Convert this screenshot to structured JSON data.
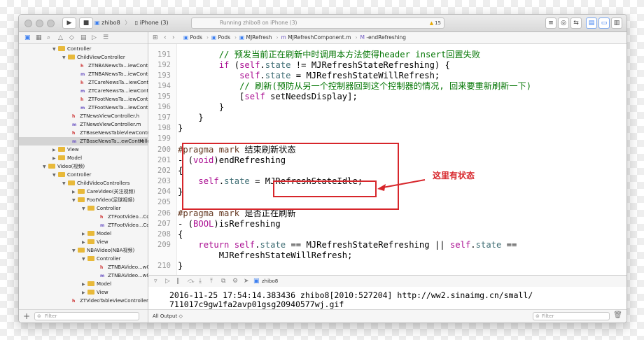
{
  "toolbar": {
    "scheme_name": "zhibo8",
    "scheme_sep": "〉",
    "device": "iPhone (3)",
    "status": "Running zhibo8 on iPhone (3)",
    "warning_count": "15"
  },
  "navigator": {
    "rows": [
      {
        "label": "Controller",
        "kind": "folder",
        "indent": 58,
        "open": true
      },
      {
        "label": "ChildViewController",
        "kind": "folder",
        "indent": 72,
        "open": true
      },
      {
        "label": "ZTNBANewsTa...iewController.h",
        "kind": "h",
        "indent": 88
      },
      {
        "label": "ZTNBANewsTa...iewController.m",
        "kind": "m",
        "indent": 88
      },
      {
        "label": "ZTCareNewsTa...iewController.h",
        "kind": "h",
        "indent": 88
      },
      {
        "label": "ZTCareNewsTa...iewController.m",
        "kind": "m",
        "indent": 88
      },
      {
        "label": "ZTFootNewsTa...iewController.h",
        "kind": "h",
        "indent": 88
      },
      {
        "label": "ZTFootNewsTa...iewController.m",
        "kind": "m",
        "indent": 88
      },
      {
        "label": "ZTNewsViewController.h",
        "kind": "h",
        "indent": 76
      },
      {
        "label": "ZTNewsViewController.m",
        "kind": "m",
        "indent": 76
      },
      {
        "label": "ZTBaseNewsTableViewController.h",
        "kind": "h",
        "indent": 76
      },
      {
        "label": "ZTBaseNewsTa...ewController.m",
        "kind": "m",
        "indent": 76,
        "selected": true,
        "badge": "M"
      },
      {
        "label": "View",
        "kind": "folder",
        "indent": 58,
        "open": false
      },
      {
        "label": "Model",
        "kind": "folder",
        "indent": 58,
        "open": false
      },
      {
        "label": "Video(视频)",
        "kind": "folder",
        "indent": 44,
        "open": true
      },
      {
        "label": "Controller",
        "kind": "folder",
        "indent": 58,
        "open": true
      },
      {
        "label": "ChildVideoControllers",
        "kind": "folder",
        "indent": 72,
        "open": true
      },
      {
        "label": "CareVideo(关注视频)",
        "kind": "folder",
        "indent": 86,
        "open": false
      },
      {
        "label": "FootVideo(足球视频)",
        "kind": "folder",
        "indent": 86,
        "open": true
      },
      {
        "label": "Controller",
        "kind": "folder",
        "indent": 100,
        "open": true
      },
      {
        "label": "ZTFootVideo...Controller.h",
        "kind": "h",
        "indent": 116
      },
      {
        "label": "ZTFootVideo...Controller.m",
        "kind": "m",
        "indent": 116
      },
      {
        "label": "Model",
        "kind": "folder",
        "indent": 100,
        "open": false
      },
      {
        "label": "View",
        "kind": "folder",
        "indent": 100,
        "open": false
      },
      {
        "label": "NBAVideo(NBA视频)",
        "kind": "folder",
        "indent": 86,
        "open": true
      },
      {
        "label": "Controller",
        "kind": "folder",
        "indent": 100,
        "open": true
      },
      {
        "label": "ZTNBAVideo...wController.h",
        "kind": "h",
        "indent": 116
      },
      {
        "label": "ZTNBAVideo...wController.m",
        "kind": "m",
        "indent": 116
      },
      {
        "label": "Model",
        "kind": "folder",
        "indent": 100,
        "open": false
      },
      {
        "label": "View",
        "kind": "folder",
        "indent": 100,
        "open": false
      },
      {
        "label": "ZTVideoTableViewController.h",
        "kind": "h",
        "indent": 76
      }
    ],
    "filter_placeholder": "Filter"
  },
  "jumpbar": {
    "crumbs": [
      "Pods",
      "Pods",
      "MJRefresh",
      "MJRefreshComponent.m",
      "-endRefreshing"
    ]
  },
  "editor": {
    "lines": [
      {
        "n": "191",
        "html": "        <span class=\"cm\">// 预发当前正在刷新中时调用本方法使得header insert回置失败</span>"
      },
      {
        "n": "192",
        "html": "        <span class=\"kw\">if</span> (<span class=\"kw\">self</span>.<span class=\"ty\">state</span> != MJRefreshStateRefreshing) {"
      },
      {
        "n": "193",
        "html": "            <span class=\"kw\">self</span>.<span class=\"ty\">state</span> = MJRefreshStateWillRefresh;"
      },
      {
        "n": "194",
        "html": "            <span class=\"cm\">// 刷新(预防从另一个控制器回到这个控制器的情况, 回来要重新刷新一下)</span>"
      },
      {
        "n": "195",
        "html": "            [<span class=\"kw\">self</span> setNeedsDisplay];"
      },
      {
        "n": "196",
        "html": "        }"
      },
      {
        "n": "197",
        "html": "    }"
      },
      {
        "n": "198",
        "html": "}"
      },
      {
        "n": "199",
        "html": ""
      },
      {
        "n": "200",
        "html": "<span class=\"pp\">#pragma mark</span> 结束刷新状态"
      },
      {
        "n": "201",
        "html": "- (<span class=\"kw\">void</span>)endRefreshing"
      },
      {
        "n": "202",
        "html": "{"
      },
      {
        "n": "203",
        "html": "    <span class=\"kw\">self</span>.<span class=\"ty\">state</span> = MJRefreshStateIdle;"
      },
      {
        "n": "204",
        "html": "}"
      },
      {
        "n": "205",
        "html": ""
      },
      {
        "n": "206",
        "html": "<span class=\"pp\">#pragma mark</span> 是否正在刷新"
      },
      {
        "n": "207",
        "html": "- (<span class=\"kw\">BOOL</span>)isRefreshing"
      },
      {
        "n": "208",
        "html": "{"
      },
      {
        "n": "209",
        "html": "    <span class=\"kw\">return</span> <span class=\"kw\">self</span>.<span class=\"ty\">state</span> == MJRefreshStateRefreshing || <span class=\"kw\">self</span>.<span class=\"ty\">state</span> =="
      },
      {
        "n": "",
        "html": "        MJRefreshStateWillRefresh;"
      },
      {
        "n": "210",
        "html": "}"
      }
    ],
    "annotation": "这里有状态"
  },
  "debug": {
    "target": "zhibo8"
  },
  "console": {
    "lines": [
      "2016-11-25 17:54:14.383436 zhibo8[2010:527204] http://ww2.sinaimg.cn/small/",
      "711017c9gw1fa2avp01gsg20940577wj.gif"
    ],
    "output_mode": "All Output ◇",
    "filter_placeholder": "Filter"
  },
  "colors": {
    "annotation_red": "#d7262b",
    "selection": "#d4d4d4",
    "keyword": "#aa0d91",
    "comment": "#007400"
  }
}
